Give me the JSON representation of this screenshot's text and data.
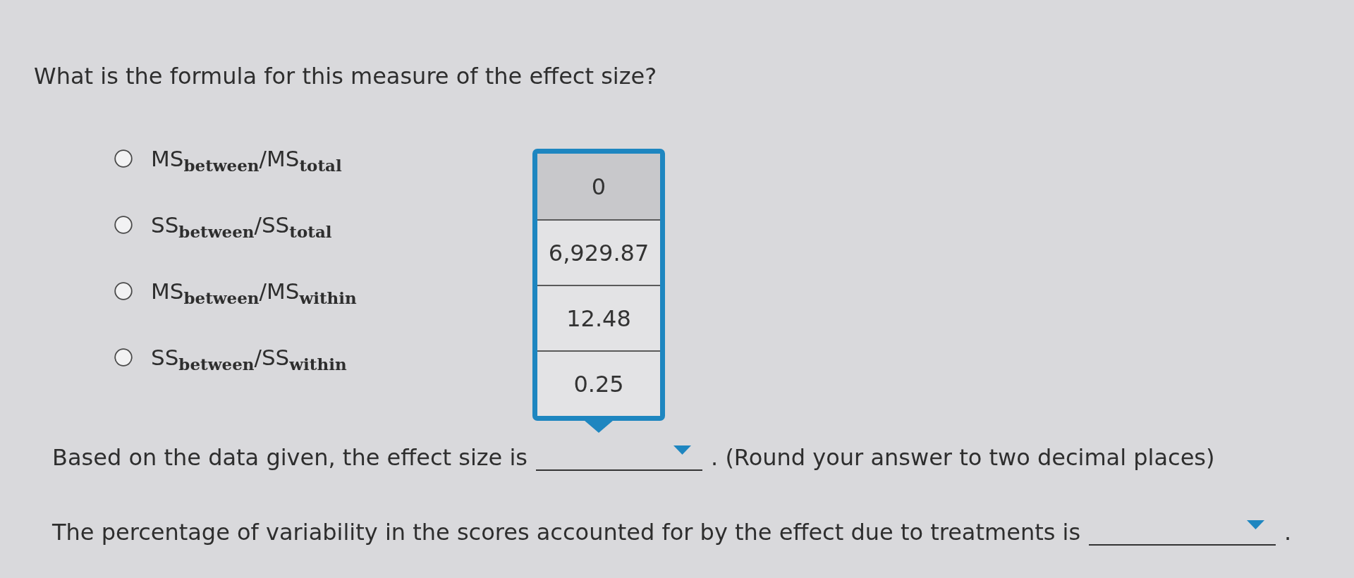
{
  "question": "What is the formula for this measure of the effect size?",
  "options": [
    {
      "label": "MS$_{between}$/MS$_{total}$",
      "selected": false
    },
    {
      "label": "SS$_{between}$/SS$_{total}$",
      "selected": false
    },
    {
      "label": "MS$_{between}$/MS$_{within}$",
      "selected": false
    },
    {
      "label": "SS$_{between}$/SS$_{within}$",
      "selected": false
    }
  ],
  "answers": [
    {
      "prompt": "Based on the data given, the effect size is",
      "open_menu": [
        {
          "label": "0",
          "selected": true
        },
        {
          "label": "6,929.87",
          "selected": false
        },
        {
          "label": "12.48",
          "selected": false
        },
        {
          "label": "0.25",
          "selected": false
        }
      ],
      "note": ". (Round your answer to two decimal places)"
    },
    {
      "prompt": "The percentage of variability in the scores accounted for by the effect due to treatments is",
      "note": "."
    }
  ]
}
